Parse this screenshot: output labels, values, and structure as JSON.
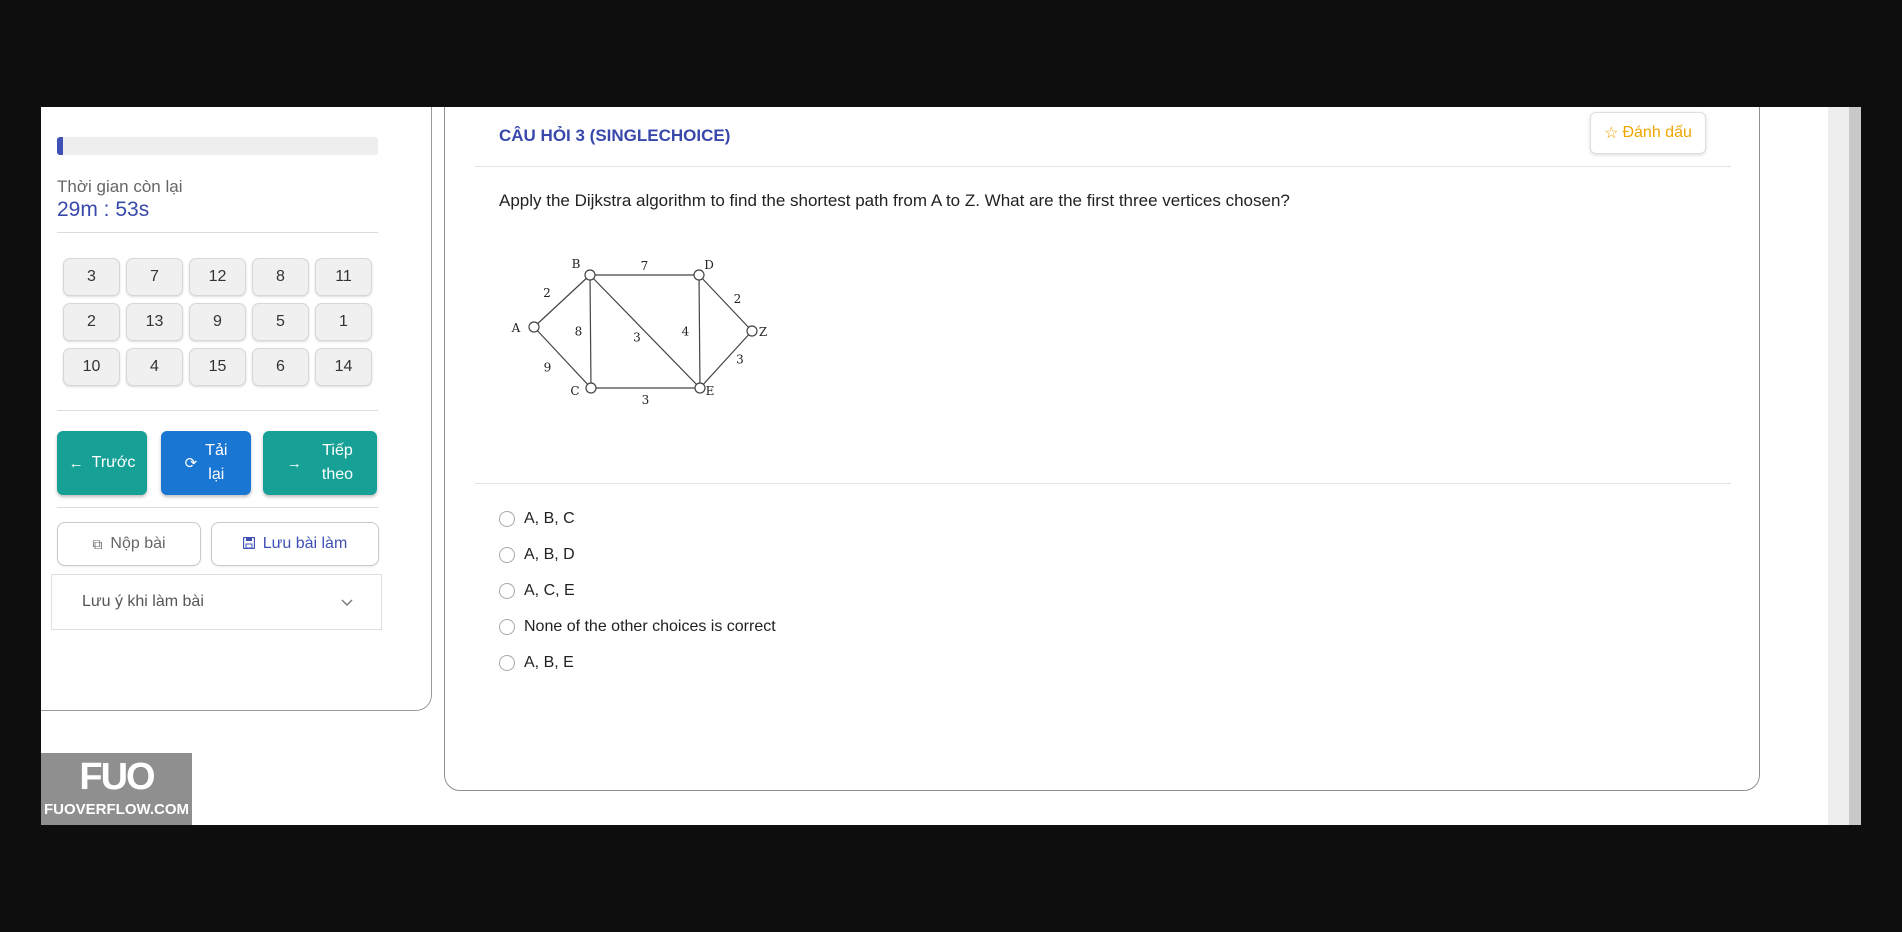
{
  "timer": {
    "label": "Thời gian còn lại",
    "value": "29m : 53s",
    "progress_fraction": 0.02
  },
  "question_grid": [
    "3",
    "7",
    "12",
    "8",
    "11",
    "2",
    "13",
    "9",
    "5",
    "1",
    "10",
    "4",
    "15",
    "6",
    "14"
  ],
  "nav": {
    "prev_label": "Trước",
    "reload_label": "Tải\nlại",
    "next_label": "Tiếp\ntheo"
  },
  "actions": {
    "submit_label": "Nộp bài",
    "save_label": "Lưu bài làm"
  },
  "notes": {
    "label": "Lưu ý khi làm bài"
  },
  "logo": {
    "mark": "FUO",
    "text": "FUOVERFLOW.COM"
  },
  "question": {
    "title": "CÂU HỎI 3 (SINGLECHOICE)",
    "mark_label": "Đánh dấu",
    "text": "Apply the Dijkstra algorithm to find the shortest path from A to Z. What are the first three vertices chosen?",
    "graph": {
      "nodes": [
        "A",
        "B",
        "C",
        "D",
        "E",
        "Z"
      ],
      "edges": [
        {
          "from": "A",
          "to": "B",
          "weight": "2"
        },
        {
          "from": "A",
          "to": "C",
          "weight": "9"
        },
        {
          "from": "B",
          "to": "D",
          "weight": "7"
        },
        {
          "from": "B",
          "to": "C",
          "weight": "8"
        },
        {
          "from": "B",
          "to": "E",
          "weight": "3"
        },
        {
          "from": "D",
          "to": "E",
          "weight": "4"
        },
        {
          "from": "D",
          "to": "Z",
          "weight": "2"
        },
        {
          "from": "C",
          "to": "E",
          "weight": "3"
        },
        {
          "from": "E",
          "to": "Z",
          "weight": "3"
        }
      ]
    },
    "options": [
      "A, B, C",
      "A, B, D",
      "A, C, E",
      "None of the other choices is correct",
      "A, B, E"
    ]
  },
  "colors": {
    "accent_indigo": "#3949ab",
    "teal_button": "#17a095",
    "blue_button": "#1976d2",
    "mark_gold": "#f0a500"
  }
}
